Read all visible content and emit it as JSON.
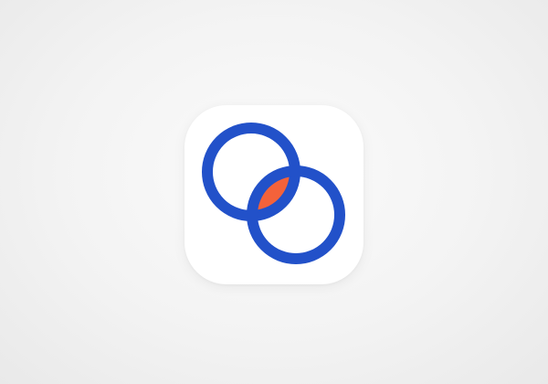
{
  "app_icon": {
    "icon": "overlapping-rings-logo",
    "colors": {
      "tile": "#ffffff",
      "ring": "#2251c9",
      "overlap": "#f4623a"
    }
  }
}
